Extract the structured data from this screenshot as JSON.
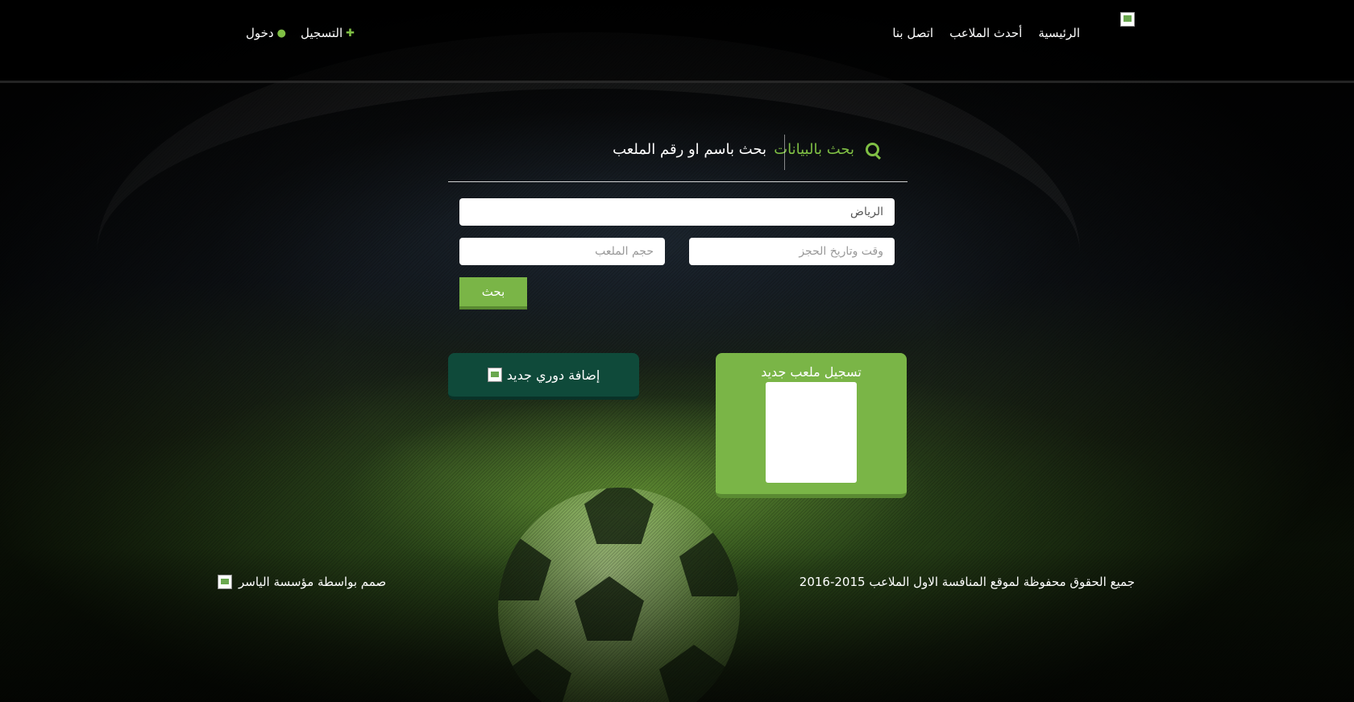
{
  "header": {
    "nav": [
      {
        "label": "الرئيسية"
      },
      {
        "label": "أحدث الملاعب"
      },
      {
        "label": "اتصل بنا"
      }
    ],
    "register_label": "التسجيل",
    "login_label": "دخول"
  },
  "search": {
    "tab_data_label": "بحث بالبيانات",
    "tab_name_label": "بحث باسم او رقم الملعب",
    "city_value": "الرياض",
    "datetime_placeholder": "وقت وتاريخ الحجز",
    "size_placeholder": "حجم الملعب",
    "button_label": "بحث"
  },
  "actions": {
    "add_league_label": "إضافة دوري جديد",
    "register_field_label": "تسجيل ملعب جديد"
  },
  "footer": {
    "copyright": "جميع الحقوق محفوظة لموقع المنافسة الاول الملاعب 2015-2016",
    "designed_by": "صمم بواسطة مؤسسة الياسر"
  },
  "colors": {
    "accent_green": "#7ab547",
    "dark_green": "#0f4a3a"
  }
}
